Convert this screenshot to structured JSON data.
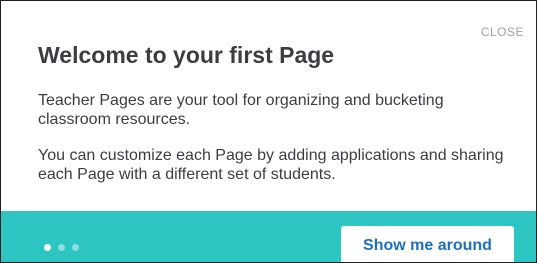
{
  "dialog": {
    "close_label": "CLOSE",
    "title": "Welcome to your first Page",
    "paragraphs": [
      "Teacher Pages are your tool for organizing and bucketing classroom resources.",
      "You can customize each Page by adding applications and sharing each Page with a different set of students."
    ]
  },
  "footer": {
    "step_count": 3,
    "current_step": 1,
    "primary_button_label": "Show me around"
  },
  "colors": {
    "accent": "#2cc5c2",
    "button_text": "#1b6fc0",
    "heading_text": "#3b3d42"
  }
}
